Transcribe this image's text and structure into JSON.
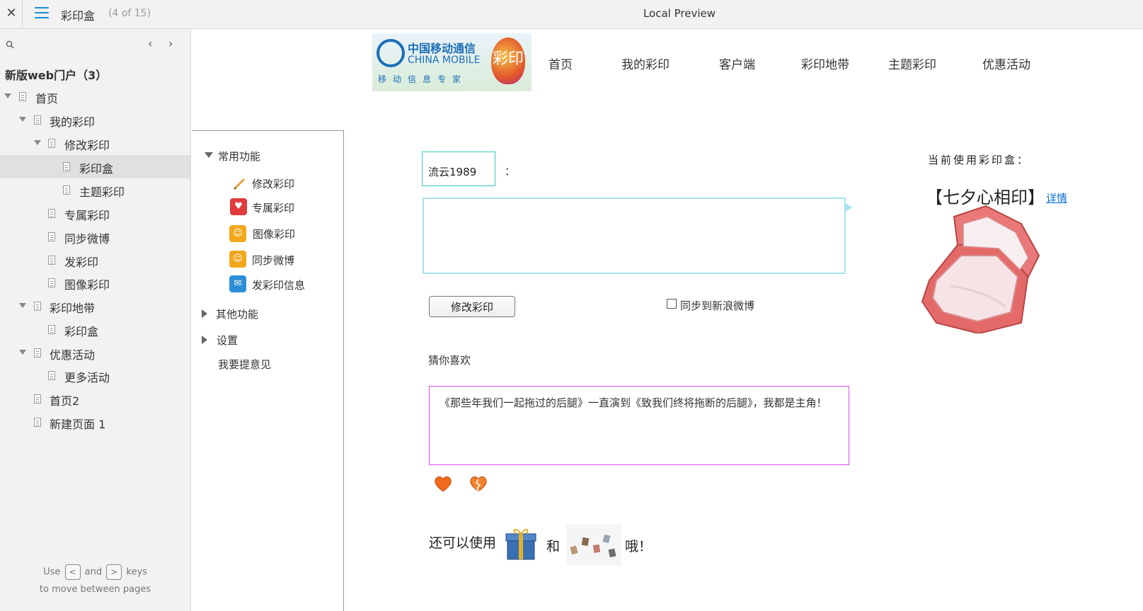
{
  "topbar": {
    "close_glyph": "✕",
    "page_name": "彩印盒",
    "page_count": "(4 of 15)",
    "window_title": "Local Preview"
  },
  "sidebar": {
    "project_title": "新版web门户（3）",
    "prev_glyph": "‹",
    "next_glyph": "›",
    "tree": [
      {
        "label": "首页"
      },
      {
        "label": "我的彩印"
      },
      {
        "label": "修改彩印"
      },
      {
        "label": "彩印盒",
        "selected": true
      },
      {
        "label": "主题彩印"
      },
      {
        "label": "专属彩印"
      },
      {
        "label": "同步微博"
      },
      {
        "label": "发彩印"
      },
      {
        "label": "图像彩印"
      },
      {
        "label": "彩印地带"
      },
      {
        "label": "彩印盒"
      },
      {
        "label": "优惠活动"
      },
      {
        "label": "更多活动"
      },
      {
        "label": "首页2"
      },
      {
        "label": "新建页面 1"
      }
    ],
    "hint": {
      "use": "Use",
      "key_prev": "<",
      "and": "and",
      "key_next": ">",
      "keys": "keys",
      "line2": "to move between pages"
    }
  },
  "logo": {
    "cn": "中国移动通信",
    "en": "CHINA MOBILE",
    "sub": "移动信息专家",
    "badge": "彩印"
  },
  "top_nav": [
    "首页",
    "我的彩印",
    "客户端",
    "彩印地带",
    "主题彩印",
    "优惠活动"
  ],
  "function_panel": {
    "common_label": "常用功能",
    "items": [
      {
        "label": "修改彩印",
        "icon": "pencil-icon",
        "color": "#e5a23c"
      },
      {
        "label": "专属彩印",
        "icon": "heart-plus-icon",
        "color": "#e23b3b"
      },
      {
        "label": "图像彩印",
        "icon": "chat-bubble-icon",
        "color": "#f2a71b"
      },
      {
        "label": "同步微博",
        "icon": "chat-bubble-icon",
        "color": "#f2a71b"
      },
      {
        "label": "发彩印信息",
        "icon": "envelope-icon",
        "color": "#2c8fd6"
      }
    ],
    "other_label": "其他功能",
    "settings_label": "设置",
    "feedback_label": "我要提意见"
  },
  "form": {
    "nickname": "流云1989",
    "colon": "：",
    "modify_button": "修改彩印",
    "sync_label": "同步到新浪微博",
    "guess_title": "猜你喜欢",
    "guess_text": "《那些年我们一起拖过的后腿》一直演到《致我们终将拖断的后腿》，我都是主角！",
    "bottom_prefix": "还可以使用",
    "bottom_and": "和",
    "bottom_suffix": "哦！"
  },
  "current": {
    "title": "当前使用彩印盒：",
    "name": "【七夕心相印】",
    "detail_link": "详情"
  },
  "colors": {
    "accent": "#1a8bd8",
    "nick_border": "#34c9b7",
    "message_border": "#a5e3ec",
    "guess_border": "#d94be6",
    "link": "#0a6ecf"
  }
}
